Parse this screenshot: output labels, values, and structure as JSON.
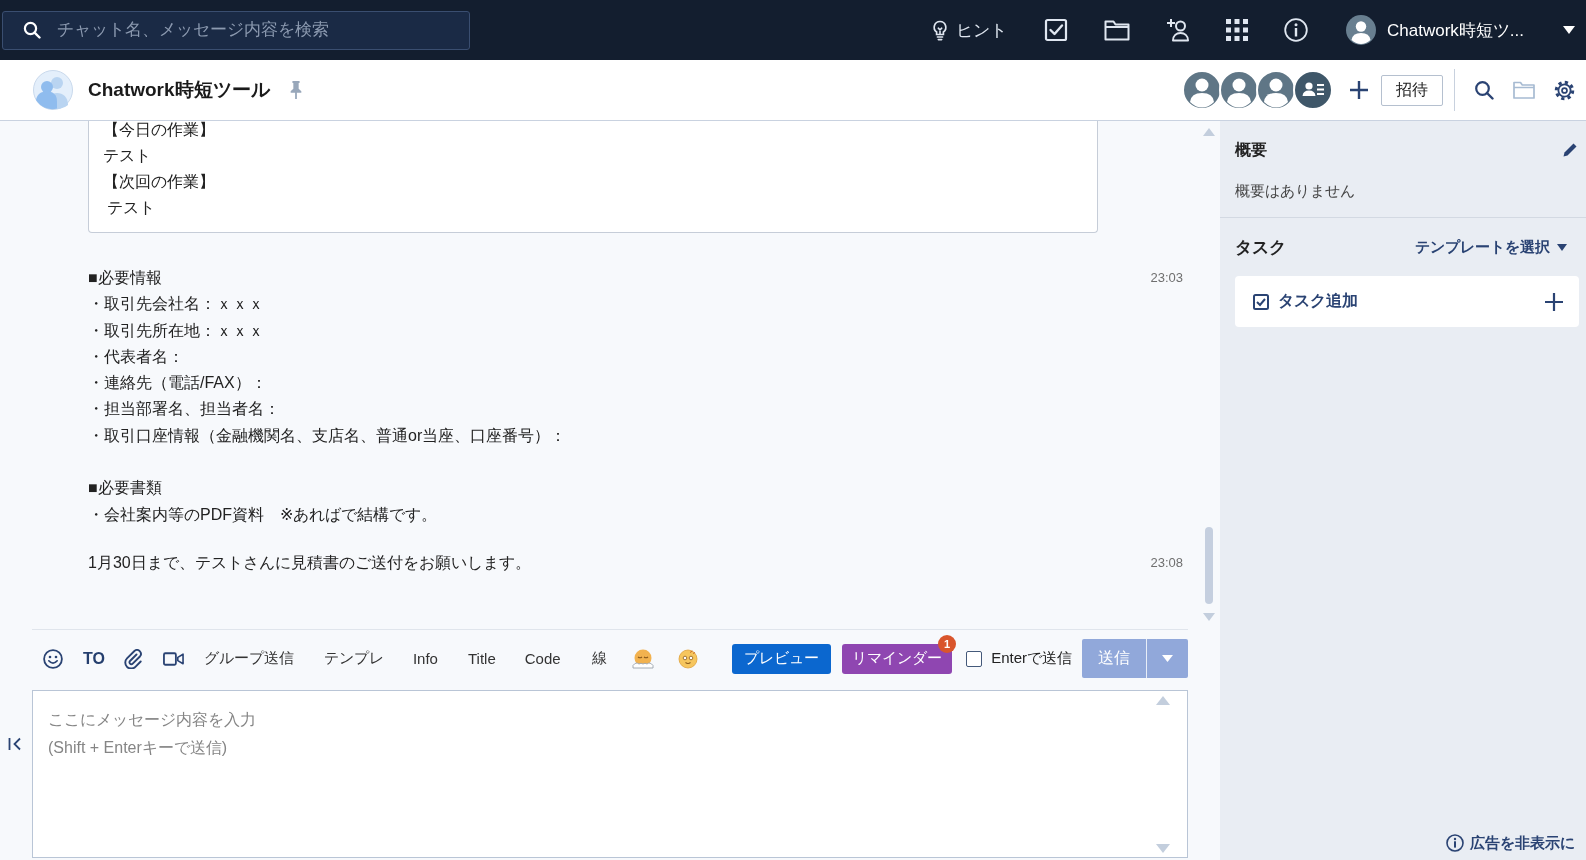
{
  "top_bar": {
    "search": {
      "placeholder": "チャット名、メッセージ内容を検索"
    },
    "hint": "ヒント",
    "user_name": "Chatwork時短ツ..."
  },
  "room_header": {
    "title": "Chatwork時短ツール",
    "invite_button": "招待"
  },
  "messages": [
    {
      "kind": "quote",
      "lines": [
        "【今日の作業】",
        "テスト",
        "【次回の作業】",
        " テスト"
      ]
    },
    {
      "kind": "text",
      "paragraphs": [
        [
          "■必要情報",
          "・取引先会社名：ｘｘｘ",
          "・取引先所在地：ｘｘｘ",
          "・代表者名：",
          "・連絡先（電話/FAX）：",
          "・担当部署名、担当者名：",
          "・取引口座情報（金融機関名、支店名、普通or当座、口座番号）："
        ],
        [
          "■必要書類",
          "・会社案内等のPDF資料　※あればで結構です。"
        ]
      ],
      "time": "23:03"
    },
    {
      "kind": "text",
      "paragraphs": [
        [
          "1月30日まで、テストさんに見積書のご送付をお願いします。"
        ]
      ],
      "time": "23:08"
    }
  ],
  "composer": {
    "to_label": "TO",
    "tools": [
      "グループ送信",
      "テンプレ",
      "Info",
      "Title",
      "Code",
      "線"
    ],
    "preview_button": "プレビュー",
    "reminder_button": {
      "label": "リマインダー",
      "badge": "1"
    },
    "enter_to_send": {
      "label": "Enterで送信",
      "checked": false
    },
    "send_button": {
      "label": "送信",
      "disabled": true
    },
    "placeholder": "ここにメッセージ内容を入力\n(Shift + Enterキーで送信)"
  },
  "side_panel": {
    "summary": {
      "title": "概要",
      "text": "概要はありません"
    },
    "tasks": {
      "title": "タスク",
      "template_link": "テンプレートを選択",
      "add_task": "タスク追加"
    },
    "hide_ads_link": "広告を非表示に"
  }
}
